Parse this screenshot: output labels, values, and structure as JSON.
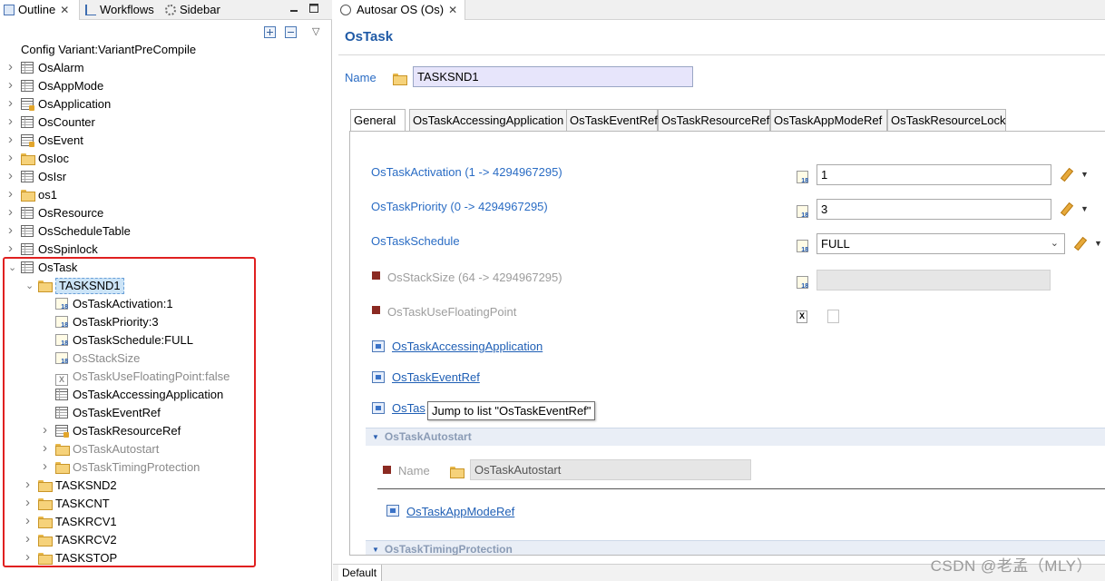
{
  "left_pane": {
    "tabs": [
      {
        "label": "Outline",
        "icon": "outline-icon",
        "closable": true
      },
      {
        "label": "Workflows",
        "icon": "workflows-icon"
      },
      {
        "label": "Sidebar",
        "icon": "sidebar-icon"
      }
    ],
    "tree": [
      {
        "label": "Config Variant:VariantPreCompile",
        "icon": "config-icon",
        "expandable": false,
        "depth": 0
      },
      {
        "label": "OsAlarm",
        "icon": "table-icon",
        "expandable": true,
        "depth": 0
      },
      {
        "label": "OsAppMode",
        "icon": "table-icon",
        "expandable": true,
        "depth": 0
      },
      {
        "label": "OsApplication",
        "icon": "table-param-icon",
        "expandable": true,
        "depth": 0
      },
      {
        "label": "OsCounter",
        "icon": "table-icon",
        "expandable": true,
        "depth": 0
      },
      {
        "label": "OsEvent",
        "icon": "table-param-icon",
        "expandable": true,
        "depth": 0
      },
      {
        "label": "OsIoc",
        "icon": "folder-icon",
        "expandable": true,
        "depth": 0
      },
      {
        "label": "OsIsr",
        "icon": "table-icon",
        "expandable": true,
        "depth": 0
      },
      {
        "label": "os1",
        "icon": "folder-icon",
        "expandable": true,
        "depth": 0
      },
      {
        "label": "OsResource",
        "icon": "table-icon",
        "expandable": true,
        "depth": 0
      },
      {
        "label": "OsScheduleTable",
        "icon": "table-icon",
        "expandable": true,
        "depth": 0
      },
      {
        "label": "OsSpinlock",
        "icon": "table-icon",
        "expandable": true,
        "depth": 0
      },
      {
        "label": "OsTask",
        "icon": "table-icon",
        "expanded": true,
        "depth": 0
      },
      {
        "label": "TASKSND1",
        "icon": "folder-open-icon",
        "expanded": true,
        "selected": true,
        "depth": 1
      },
      {
        "label": "OsTaskActivation:1",
        "icon": "param-icon",
        "depth": 2
      },
      {
        "label": "OsTaskPriority:3",
        "icon": "param-icon",
        "depth": 2
      },
      {
        "label": "OsTaskSchedule:FULL",
        "icon": "param-icon",
        "depth": 2
      },
      {
        "label": "OsStackSize",
        "icon": "param-icon",
        "depth": 2,
        "disabled": true
      },
      {
        "label": "OsTaskUseFloatingPoint:false",
        "icon": "boolean-param-icon",
        "depth": 2,
        "disabled": true
      },
      {
        "label": "OsTaskAccessingApplication",
        "icon": "table-icon",
        "depth": 2
      },
      {
        "label": "OsTaskEventRef",
        "icon": "table-icon",
        "depth": 2
      },
      {
        "label": "OsTaskResourceRef",
        "icon": "table-param-icon",
        "expandable": true,
        "depth": 2
      },
      {
        "label": "OsTaskAutostart",
        "icon": "folder-icon",
        "expandable": true,
        "depth": 2,
        "disabled": true
      },
      {
        "label": "OsTaskTimingProtection",
        "icon": "folder-icon",
        "expandable": true,
        "depth": 2,
        "disabled": true
      },
      {
        "label": "TASKSND2",
        "icon": "folder-icon",
        "expandable": true,
        "depth": 1
      },
      {
        "label": "TASKCNT",
        "icon": "folder-icon",
        "expandable": true,
        "depth": 1
      },
      {
        "label": "TASKRCV1",
        "icon": "folder-icon",
        "expandable": true,
        "depth": 1
      },
      {
        "label": "TASKRCV2",
        "icon": "folder-icon",
        "expandable": true,
        "depth": 1
      },
      {
        "label": "TASKSTOP",
        "icon": "folder-icon",
        "expandable": true,
        "depth": 1
      }
    ]
  },
  "editor": {
    "tab_label": "Autosar OS (Os)",
    "form_title": "OsTask",
    "name_label": "Name",
    "name_value": "TASKSND1",
    "page_tabs": [
      "General",
      "OsTaskAccessingApplication",
      "OsTaskEventRef",
      "OsTaskResourceRef",
      "OsTaskAppModeRef",
      "OsTaskResourceLock"
    ],
    "fields": {
      "activation": {
        "label": "OsTaskActivation (1 -> 4294967295)",
        "value": "1"
      },
      "priority": {
        "label": "OsTaskPriority (0 -> 4294967295)",
        "value": "3"
      },
      "schedule": {
        "label": "OsTaskSchedule",
        "value": "FULL"
      },
      "stack_size": {
        "label": "OsStackSize (64 -> 4294967295)",
        "value": ""
      },
      "floating_point": {
        "label": "OsTaskUseFloatingPoint"
      }
    },
    "links": {
      "accessing_application": "OsTaskAccessingApplication",
      "event_ref": "OsTaskEventRef",
      "resource_ref_partial": "OsTas"
    },
    "tooltip": "Jump to list \"OsTaskEventRef\"",
    "sections": {
      "autostart": {
        "title": "OsTaskAutostart",
        "name_label": "Name",
        "name_value": "OsTaskAutostart",
        "link": "OsTaskAppModeRef"
      },
      "timing_protection": {
        "title": "OsTaskTimingProtection"
      }
    },
    "bottom_tab": "Default"
  },
  "watermark": "CSDN @老孟（MLY）",
  "colors": {
    "link_blue": "#1f5fb5",
    "title_blue": "#1f5aa6",
    "name_field_bg": "#e7e5fb",
    "highlight_box": "#e02020"
  }
}
